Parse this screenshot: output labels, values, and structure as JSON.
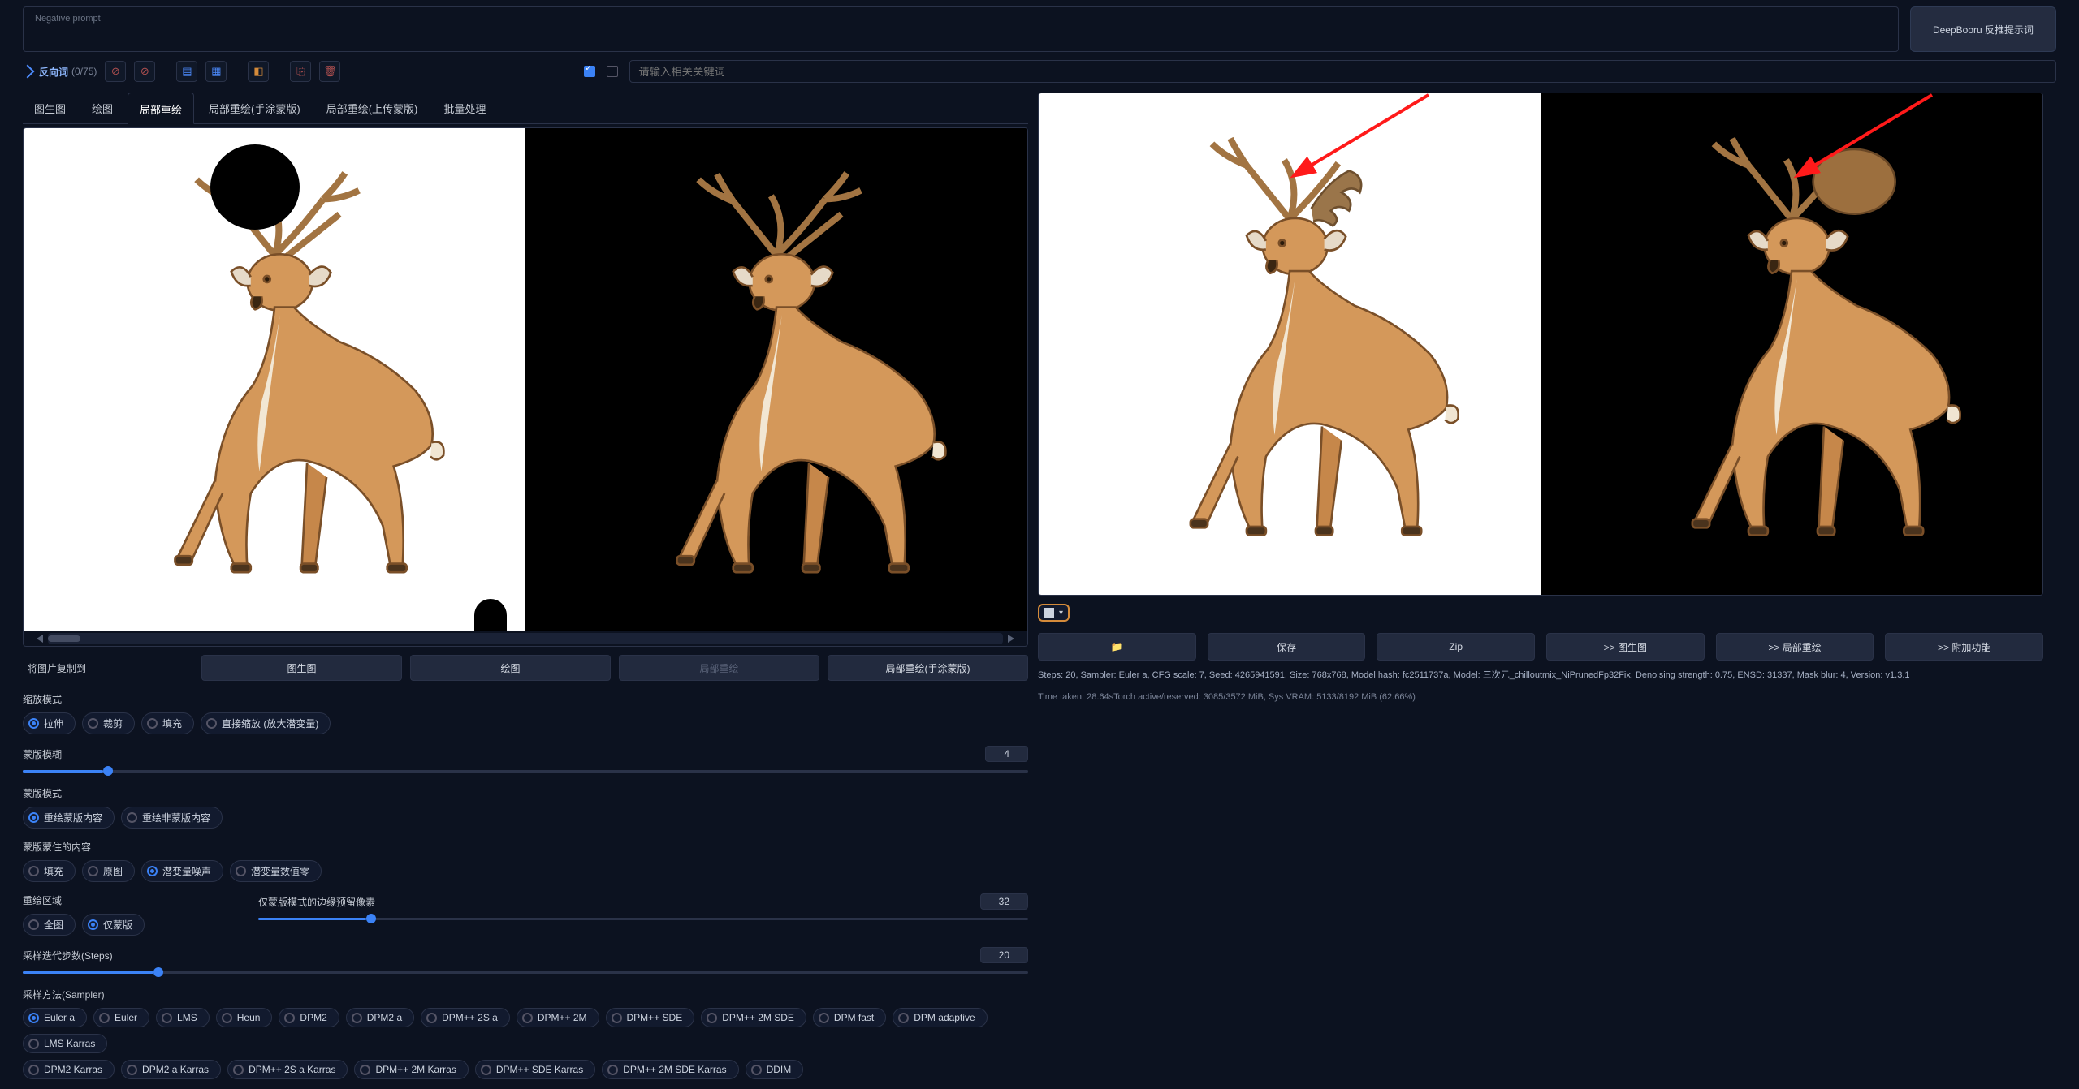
{
  "negative_prompt_label": "Negative prompt",
  "deepbooru_label": "DeepBooru 反推提示词",
  "negword_text": "反向词",
  "negword_count": "(0/75)",
  "keyword_placeholder": "请输入相关关键词",
  "tabs": [
    "图生图",
    "绘图",
    "局部重绘",
    "局部重绘(手涂蒙版)",
    "局部重绘(上传蒙版)",
    "批量处理"
  ],
  "copy_label": "将图片复制到",
  "copy_buttons": [
    "图生图",
    "绘图",
    "局部重绘",
    "局部重绘(手涂蒙版)"
  ],
  "resize_mode_label": "缩放模式",
  "resize_modes": [
    "拉伸",
    "裁剪",
    "填充",
    "直接缩放 (放大潜变量)"
  ],
  "mask_blur_label": "蒙版模糊",
  "mask_blur_value": "4",
  "mask_mode_label": "蒙版模式",
  "mask_modes": [
    "重绘蒙版内容",
    "重绘非蒙版内容"
  ],
  "masked_content_label": "蒙版蒙住的内容",
  "masked_contents": [
    "填充",
    "原图",
    "潜变量噪声",
    "潜变量数值零"
  ],
  "inpaint_area_label": "重绘区域",
  "inpaint_areas": [
    "全图",
    "仅蒙版"
  ],
  "padding_label": "仅蒙版模式的边缘预留像素",
  "padding_value": "32",
  "steps_label": "采样迭代步数(Steps)",
  "steps_value": "20",
  "sampler_label": "采样方法(Sampler)",
  "samplers_row1": [
    "Euler a",
    "Euler",
    "LMS",
    "Heun",
    "DPM2",
    "DPM2 a",
    "DPM++ 2S a",
    "DPM++ 2M",
    "DPM++ SDE",
    "DPM++ 2M SDE",
    "DPM fast",
    "DPM adaptive",
    "LMS Karras"
  ],
  "samplers_row2": [
    "DPM2 Karras",
    "DPM2 a Karras",
    "DPM++ 2S a Karras",
    "DPM++ 2M Karras",
    "DPM++ SDE Karras",
    "DPM++ 2M SDE Karras",
    "DDIM"
  ],
  "output_actions": {
    "folder": "📁",
    "save": "保存",
    "zip": "Zip",
    "img2img": ">> 图生图",
    "inpaint": ">> 局部重绘",
    "extras": ">> 附加功能"
  },
  "gen_info": "Steps: 20, Sampler: Euler a, CFG scale: 7, Seed: 4265941591, Size: 768x768, Model hash: fc2511737a, Model: 三次元_chilloutmix_NiPrunedFp32Fix, Denoising strength: 0.75, ENSD: 31337, Mask blur: 4, Version: v1.3.1",
  "time_info": "Time taken: 28.64sTorch active/reserved: 3085/3572 MiB, Sys VRAM: 5133/8192 MiB (62.66%)"
}
